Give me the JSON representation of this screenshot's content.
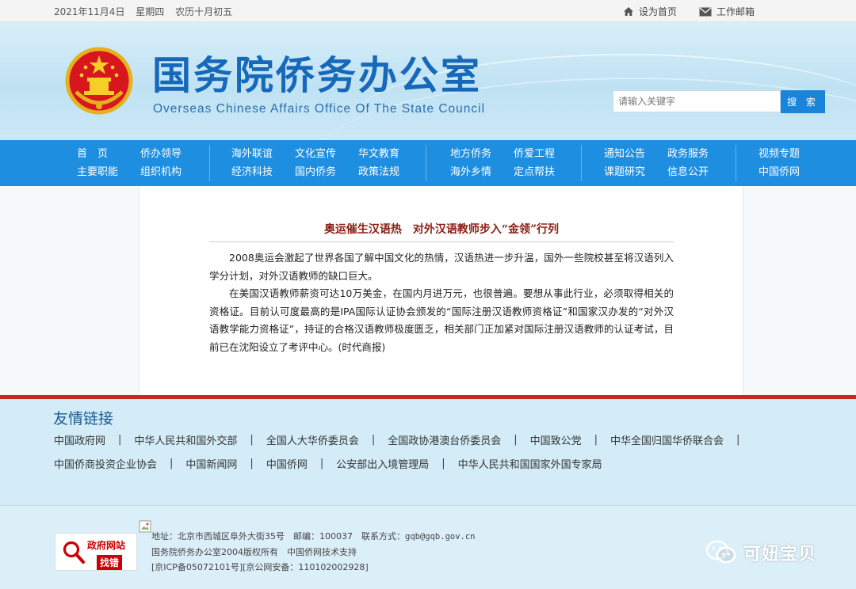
{
  "topbar": {
    "date": "2021年11月4日",
    "weekday": "星期四",
    "lunar": "农历十月初五",
    "set_home": "设为首页",
    "work_mail": "工作邮箱"
  },
  "header": {
    "title_cn": "国务院侨务办公室",
    "title_en": "Overseas Chinese Affairs Office Of The State Council",
    "search_placeholder": "请输入关键字",
    "search_button": "搜 索"
  },
  "nav": {
    "groups": [
      [
        "首　页",
        "主要职能",
        "侨办领导",
        "组织机构"
      ],
      [
        "海外联谊",
        "经济科技",
        "文化宣传",
        "国内侨务",
        "华文教育",
        "政策法规"
      ],
      [
        "地方侨务",
        "海外乡情",
        "侨爱工程",
        "定点帮扶"
      ],
      [
        "通知公告",
        "课题研究",
        "政务服务",
        "信息公开"
      ],
      [
        "视频专题",
        "中国侨网"
      ]
    ]
  },
  "article": {
    "title": "奥运催生汉语热　对外汉语教师步入“金领”行列",
    "p1": "2008奥运会激起了世界各国了解中国文化的热情，汉语热进一步升温，国外一些院校甚至将汉语列入学分计划，对外汉语教师的缺口巨大。",
    "p2": "在美国汉语教师薪资可达10万美金，在国内月进万元，也很普遍。要想从事此行业，必须取得相关的资格证。目前认可度最高的是IPA国际认证协会颁发的“国际注册汉语教师资格证”和国家汉办发的“对外汉语教学能力资格证”，持证的合格汉语教师极度匮乏，相关部门正加紧对国际注册汉语教师的认证考试，目前已在沈阳设立了考评中心。(时代商报)"
  },
  "friend_links": {
    "heading": "友情链接",
    "row1": [
      "中国政府网",
      "中华人民共和国外交部",
      "全国人大华侨委员会",
      "全国政协港澳台侨委员会",
      "中国致公党",
      "中华全国归国华侨联合会"
    ],
    "row2": [
      "中国侨商投资企业协会",
      "中国新闻网",
      "中国侨网",
      "公安部出入境管理局",
      "中华人民共和国国家外国专家局"
    ]
  },
  "footer": {
    "badge_line1": "政府网站",
    "badge_line2": "找错",
    "address_label": "地址：",
    "address": "北京市西城区阜外大街35号",
    "zip_label": "邮编：",
    "zip": "100037",
    "contact_label": "联系方式：",
    "contact": "gqb@gqb.gov.cn",
    "copyright": "国务院侨务办公室2004版权所有　中国侨网技术支持",
    "icp": "[京ICP备05072101号]",
    "police": "[京公网安备：110102002928]",
    "watermark": "可妞宝贝"
  },
  "colors": {
    "nav_bg": "#1e8ee0",
    "title_blue": "#1668b9",
    "article_title": "#8a1f14",
    "accent_red": "#c62a20",
    "links_bg": "#d3ecf8"
  }
}
